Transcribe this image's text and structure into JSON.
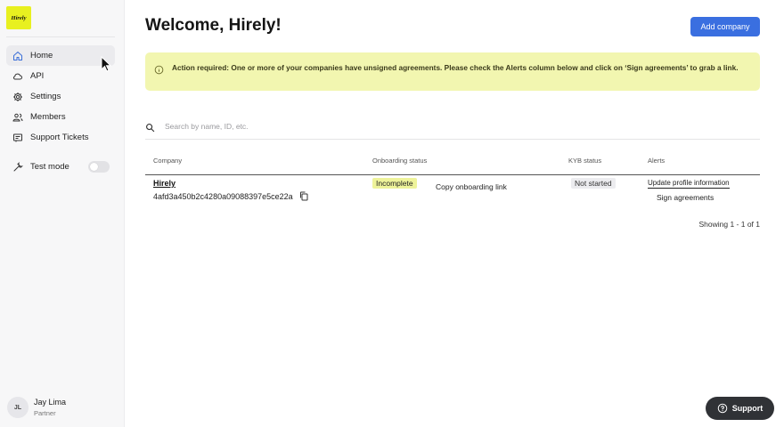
{
  "brand": {
    "logo_text": "Hirely"
  },
  "sidebar": {
    "items": [
      {
        "label": "Home",
        "icon": "home-icon",
        "active": true
      },
      {
        "label": "API",
        "icon": "cloud-icon"
      },
      {
        "label": "Settings",
        "icon": "gear-icon"
      },
      {
        "label": "Members",
        "icon": "members-icon"
      },
      {
        "label": "Support Tickets",
        "icon": "ticket-icon"
      }
    ],
    "test_mode": {
      "label": "Test mode",
      "enabled": false
    }
  },
  "user": {
    "initials": "JL",
    "name": "Jay Lima",
    "role": "Partner"
  },
  "header": {
    "title": "Welcome, Hirely!",
    "add_button": "Add company"
  },
  "alert": {
    "text": "Action required: One or more of your companies have unsigned agreements. Please check the Alerts column below and click on ‘Sign agreements’ to grab a link."
  },
  "search": {
    "placeholder": "Search by name, ID, etc."
  },
  "table": {
    "columns": [
      "Company",
      "Onboarding status",
      "KYB status",
      "Alerts"
    ],
    "rows": [
      {
        "company_name": "Hirely",
        "company_id": "4afd3a450b2c4280a09088397e5ce22a",
        "onboarding_status": "Incomplete",
        "onboarding_action": "Copy onboarding link",
        "kyb_status": "Not started",
        "alerts": [
          "Update profile information",
          "Sign agreements"
        ]
      }
    ]
  },
  "pagination": {
    "text": "Showing 1 - 1 of 1"
  },
  "support": {
    "label": "Support"
  },
  "colors": {
    "accent": "#3a6fe0",
    "logo_bg": "#e8f020",
    "alert_bg": "#f2f6b0",
    "badge_incomplete": "#eef39a"
  }
}
